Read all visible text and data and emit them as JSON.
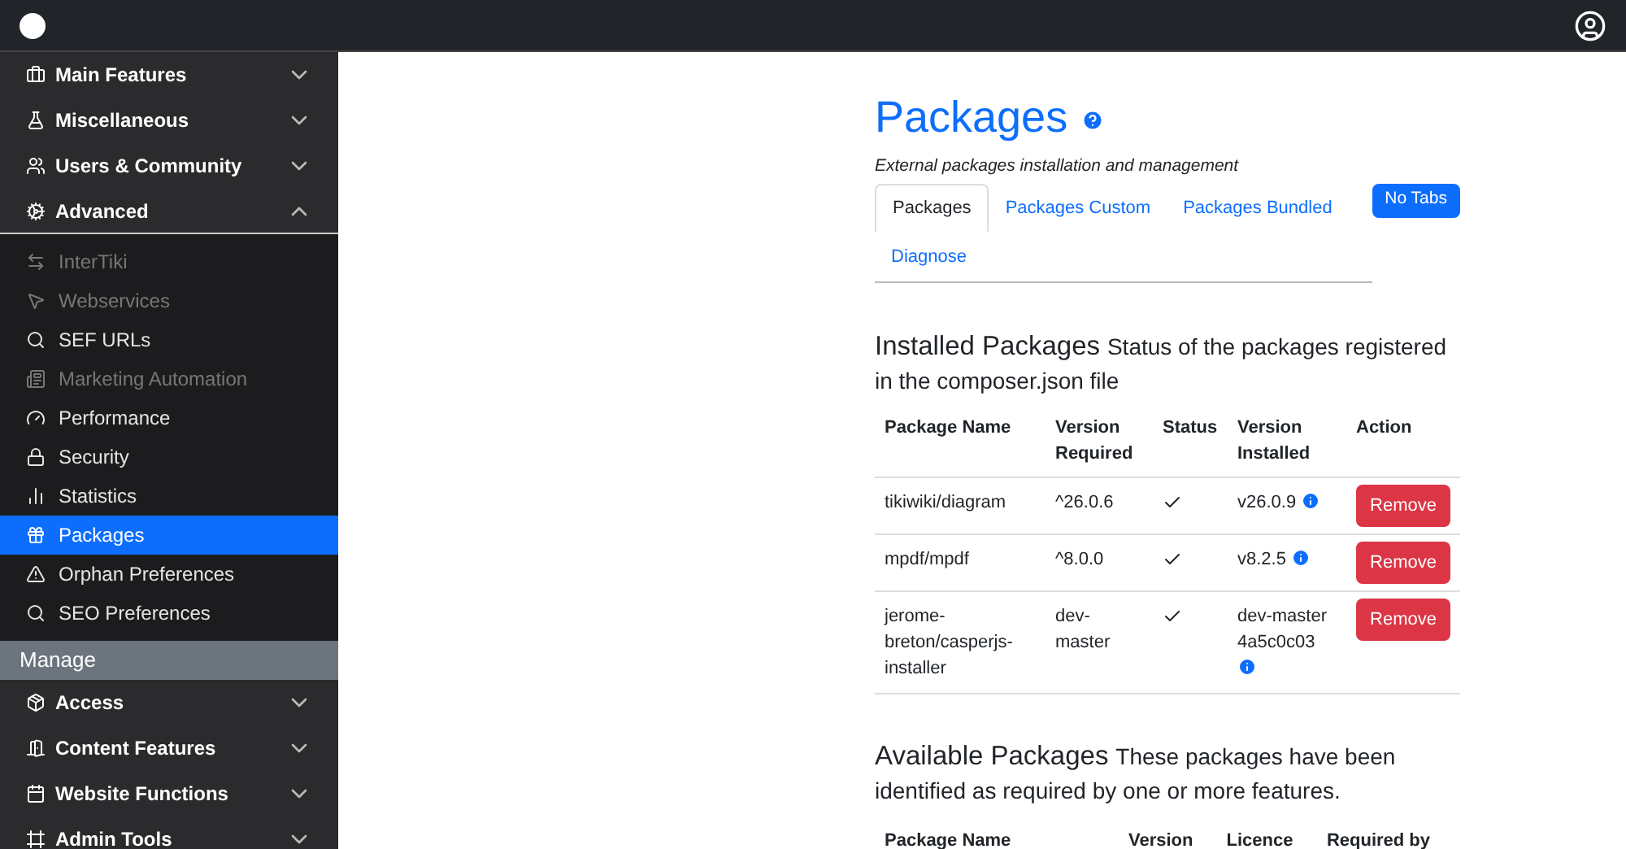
{
  "sidebar": {
    "items": [
      {
        "kind": "section",
        "label": "Main Features",
        "expanded": false
      },
      {
        "kind": "section",
        "label": "Miscellaneous",
        "expanded": false
      },
      {
        "kind": "section",
        "label": "Users & Community",
        "expanded": false
      },
      {
        "kind": "section",
        "label": "Advanced",
        "expanded": true,
        "children": [
          {
            "label": "InterTiki",
            "selected": false,
            "disabled": true
          },
          {
            "label": "Webservices",
            "selected": false,
            "disabled": true
          },
          {
            "label": "SEF URLs",
            "selected": false,
            "disabled": false
          },
          {
            "label": "Marketing Automation",
            "selected": false,
            "disabled": true
          },
          {
            "label": "Performance",
            "selected": false,
            "disabled": false
          },
          {
            "label": "Security",
            "selected": false,
            "disabled": false
          },
          {
            "label": "Statistics",
            "selected": false,
            "disabled": false
          },
          {
            "label": "Packages",
            "selected": true,
            "disabled": false
          },
          {
            "label": "Orphan Preferences",
            "selected": false,
            "disabled": false
          },
          {
            "label": "SEO Preferences",
            "selected": false,
            "disabled": false
          }
        ]
      },
      {
        "kind": "group",
        "label": "Manage"
      },
      {
        "kind": "section",
        "label": "Access",
        "expanded": false
      },
      {
        "kind": "section",
        "label": "Content Features",
        "expanded": false
      },
      {
        "kind": "section",
        "label": "Website Functions",
        "expanded": false
      },
      {
        "kind": "section",
        "label": "Admin Tools",
        "expanded": false
      }
    ]
  },
  "page": {
    "title": "Packages",
    "subtitle": "External packages installation and management",
    "tabs": [
      {
        "label": "Packages",
        "selected": true
      },
      {
        "label": "Packages Custom",
        "selected": false
      },
      {
        "label": "Packages Bundled",
        "selected": false
      },
      {
        "label": "Diagnose",
        "selected": false
      }
    ],
    "no_tabs_button": "No Tabs",
    "installed": {
      "title": "Installed Packages",
      "description": "Status of the packages registered in the composer.json file",
      "columns": [
        "Package Name",
        "Version Required",
        "Status",
        "Version Installed",
        "Action"
      ],
      "rows": [
        {
          "name": "tikiwiki/diagram",
          "required": "^26.0.6",
          "ok": true,
          "installed": "v26.0.9",
          "action": "Remove"
        },
        {
          "name": "mpdf/mpdf",
          "required": "^8.0.0",
          "ok": true,
          "installed": "v8.2.5",
          "action": "Remove"
        },
        {
          "name": "jerome-breton/casperjs-installer",
          "required": "dev-master",
          "ok": true,
          "installed": "dev-master 4a5c0c03",
          "action": "Remove"
        }
      ]
    },
    "available": {
      "title": "Available Packages",
      "description": "These packages have been identified as required by one or more features.",
      "columns": [
        "Package Name",
        "Version",
        "Licence",
        "Required by"
      ]
    }
  }
}
